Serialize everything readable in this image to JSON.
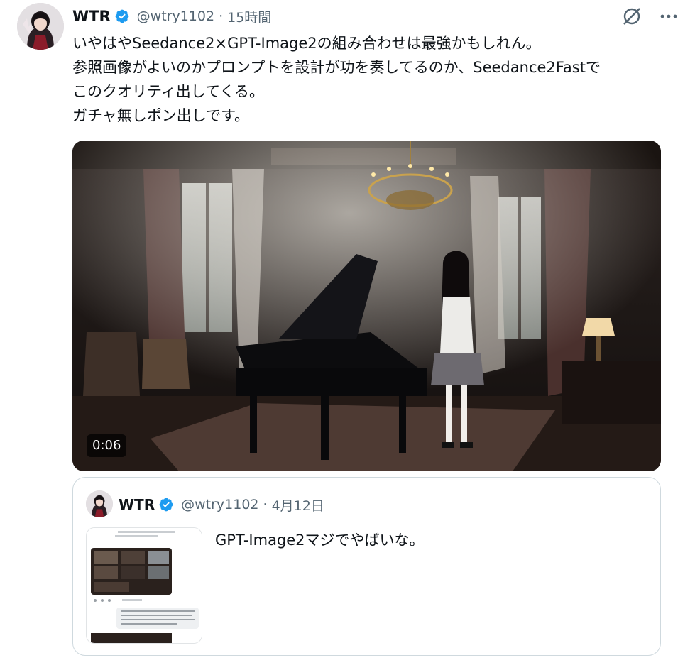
{
  "tweet": {
    "author_name": "WTR",
    "handle": "@wtry1102",
    "time": "15時間",
    "text_lines": [
      "いやはやSeedance2×GPT-Image2の組み合わせは最強かもしれん。",
      "参照画像がよいのかプロンプトを設計が功を奏してるのか、Seedance2Fastで",
      "このクオリティ出してくる。",
      "ガチャ無しポン出しです。"
    ],
    "video_duration": "0:06"
  },
  "quoted": {
    "author_name": "WTR",
    "handle": "@wtry1102",
    "date": "4月12日",
    "text": "GPT-Image2マジでやばいな。"
  },
  "icons": {
    "verified": "verified-badge-icon",
    "grok": "grok-icon",
    "more": "more-options-icon"
  },
  "colors": {
    "verified_blue": "#1d9bf0",
    "secondary_text": "#536471",
    "primary_text": "#0f1419",
    "border": "#cfd9de"
  }
}
